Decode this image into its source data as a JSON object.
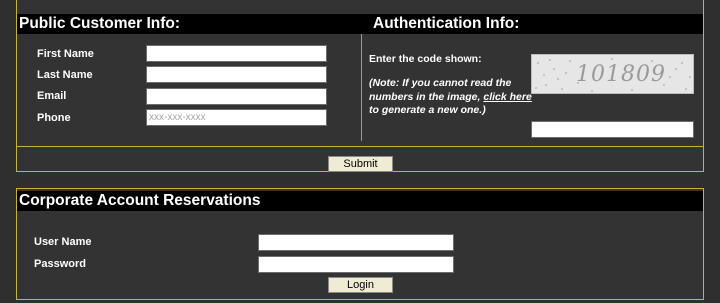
{
  "public_customer": {
    "heading": "Public Customer Info:",
    "fields": [
      {
        "label": "First Name",
        "value": "",
        "placeholder": ""
      },
      {
        "label": "Last Name",
        "value": "",
        "placeholder": ""
      },
      {
        "label": "Email",
        "value": "",
        "placeholder": ""
      },
      {
        "label": "Phone",
        "value": "",
        "placeholder": "xxx-xxx-xxxx"
      }
    ]
  },
  "authentication": {
    "heading": "Authentication Info:",
    "prompt": "Enter the code shown:",
    "note_prefix": "(Note: If you cannot read the numbers in the image, ",
    "note_link": "click here",
    "note_suffix": " to generate a new one.)",
    "captcha_code": "101809",
    "code_input_value": ""
  },
  "submit_button": "Submit",
  "corporate": {
    "heading": "Corporate Account Reservations",
    "username_label": "User Name",
    "password_label": "Password",
    "login_button": "Login"
  },
  "colors": {
    "panel_border": "#c9b23a",
    "header_bg": "#000000",
    "panel_bg": "#333333",
    "button_bg": "#f0ebd3"
  }
}
